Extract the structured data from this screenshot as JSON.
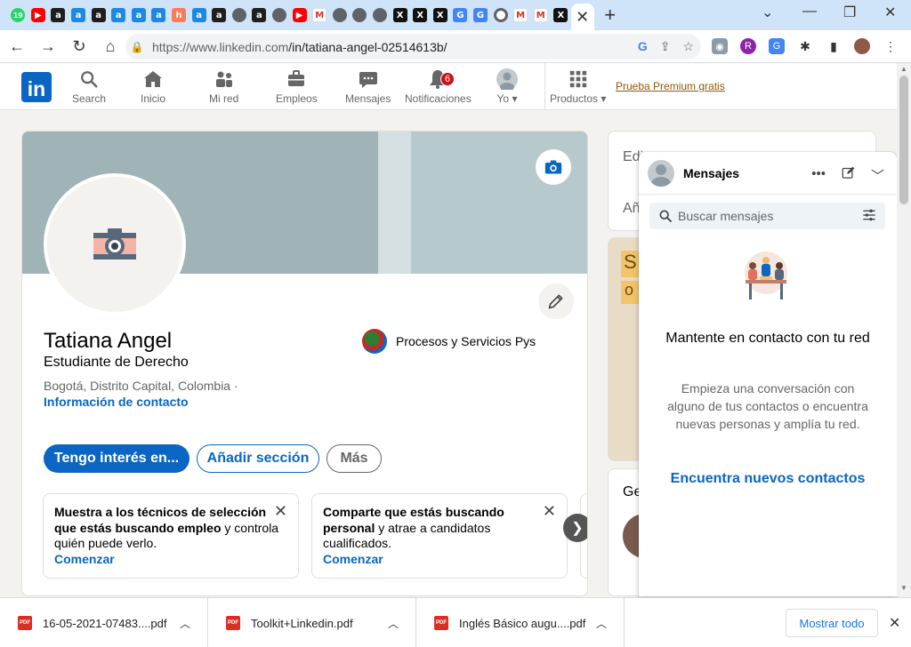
{
  "browser": {
    "tab_favicons": [
      {
        "name": "whatsapp",
        "glyph": "19"
      },
      {
        "name": "youtube",
        "glyph": "▶"
      },
      {
        "name": "a-dark",
        "glyph": "a"
      },
      {
        "name": "a-blue",
        "glyph": "a"
      },
      {
        "name": "a-dark",
        "glyph": "a"
      },
      {
        "name": "a-blue",
        "glyph": "a"
      },
      {
        "name": "a-blue",
        "glyph": "a"
      },
      {
        "name": "a-blue",
        "glyph": "a"
      },
      {
        "name": "hubspot",
        "glyph": "h"
      },
      {
        "name": "a-blue",
        "glyph": "a"
      },
      {
        "name": "a-dark",
        "glyph": "a"
      },
      {
        "name": "globe",
        "glyph": ""
      },
      {
        "name": "a-dark",
        "glyph": "a"
      },
      {
        "name": "globe",
        "glyph": ""
      },
      {
        "name": "youtube",
        "glyph": "▶"
      },
      {
        "name": "gmail",
        "glyph": "M"
      },
      {
        "name": "globe",
        "glyph": ""
      },
      {
        "name": "globe",
        "glyph": ""
      },
      {
        "name": "globe",
        "glyph": ""
      },
      {
        "name": "x",
        "glyph": "X"
      },
      {
        "name": "x",
        "glyph": "X"
      },
      {
        "name": "x",
        "glyph": "X"
      },
      {
        "name": "translate",
        "glyph": "G"
      },
      {
        "name": "translate",
        "glyph": "G"
      },
      {
        "name": "chrome",
        "glyph": ""
      },
      {
        "name": "gmail",
        "glyph": "M"
      },
      {
        "name": "gmail",
        "glyph": "M"
      },
      {
        "name": "x",
        "glyph": "X"
      }
    ],
    "active_tab_close": "✕",
    "new_tab": "+",
    "url_host": "https://www.linkedin.com",
    "url_path": "/in/tatiana-angel-02514613b/"
  },
  "linkedin": {
    "logo": "in",
    "nav": [
      {
        "id": "search",
        "label": "Search"
      },
      {
        "id": "home",
        "label": "Inicio"
      },
      {
        "id": "network",
        "label": "Mi red"
      },
      {
        "id": "jobs",
        "label": "Empleos"
      },
      {
        "id": "messaging",
        "label": "Mensajes"
      },
      {
        "id": "notifications",
        "label": "Notificaciones",
        "badge": "6"
      },
      {
        "id": "me",
        "label": "Yo"
      },
      {
        "id": "products",
        "label": "Productos"
      }
    ],
    "premium_link": "Prueba Premium gratis"
  },
  "profile": {
    "name": "Tatiana Angel",
    "headline": "Estudiante de Derecho",
    "location": "Bogotá, Distrito Capital, Colombia ·",
    "contact_link": "Información de contacto",
    "company": "Procesos y Servicios Pys",
    "buttons": {
      "primary": "Tengo interés en...",
      "add_section": "Añadir sección",
      "more": "Más"
    },
    "suggestions": [
      {
        "bold": "Muestra a los técnicos de selección que estás buscando empleo",
        "rest": " y controla quién puede verlo.",
        "cta": "Comenzar"
      },
      {
        "bold": "Comparte que estás buscando personal",
        "rest": " y atrae a candidatos cualificados.",
        "cta": "Comenzar"
      }
    ]
  },
  "right_column": {
    "card1_line1": "Edi",
    "card1_line2": "Añ",
    "card2_text": "Ge"
  },
  "messaging": {
    "title": "Mensajes",
    "search_placeholder": "Buscar mensajes",
    "empty_title": "Mantente en contacto con tu red",
    "empty_body": "Empieza una conversación con alguno de tus contactos o encuentra nuevas personas y amplía tu red.",
    "cta": "Encuentra nuevos contactos"
  },
  "downloads": {
    "items": [
      {
        "name": "16-05-2021-07483....pdf"
      },
      {
        "name": "Toolkit+Linkedin.pdf"
      },
      {
        "name": "Inglés Básico augu....pdf"
      }
    ],
    "show_all": "Mostrar todo"
  },
  "colors": {
    "linkedin_blue": "#0a66c2",
    "premium": "#915907",
    "badge": "#cc1016"
  }
}
